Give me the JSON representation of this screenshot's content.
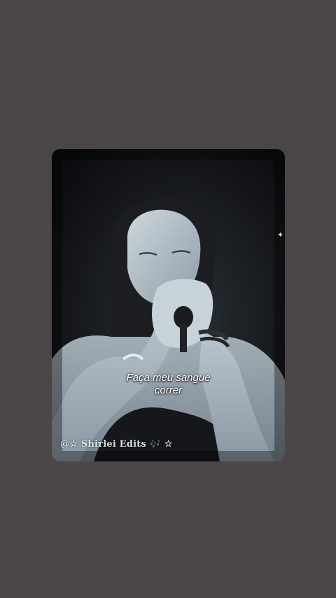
{
  "video": {
    "lyric_lines": [
      "Faça meu sangue",
      "correr"
    ],
    "watermark": "@☆ Shirlei Edits 🎶 ☆"
  },
  "colors": {
    "background": "#4b4548",
    "card_background": "#0d0e10",
    "lyric_text": "#ffffff"
  }
}
